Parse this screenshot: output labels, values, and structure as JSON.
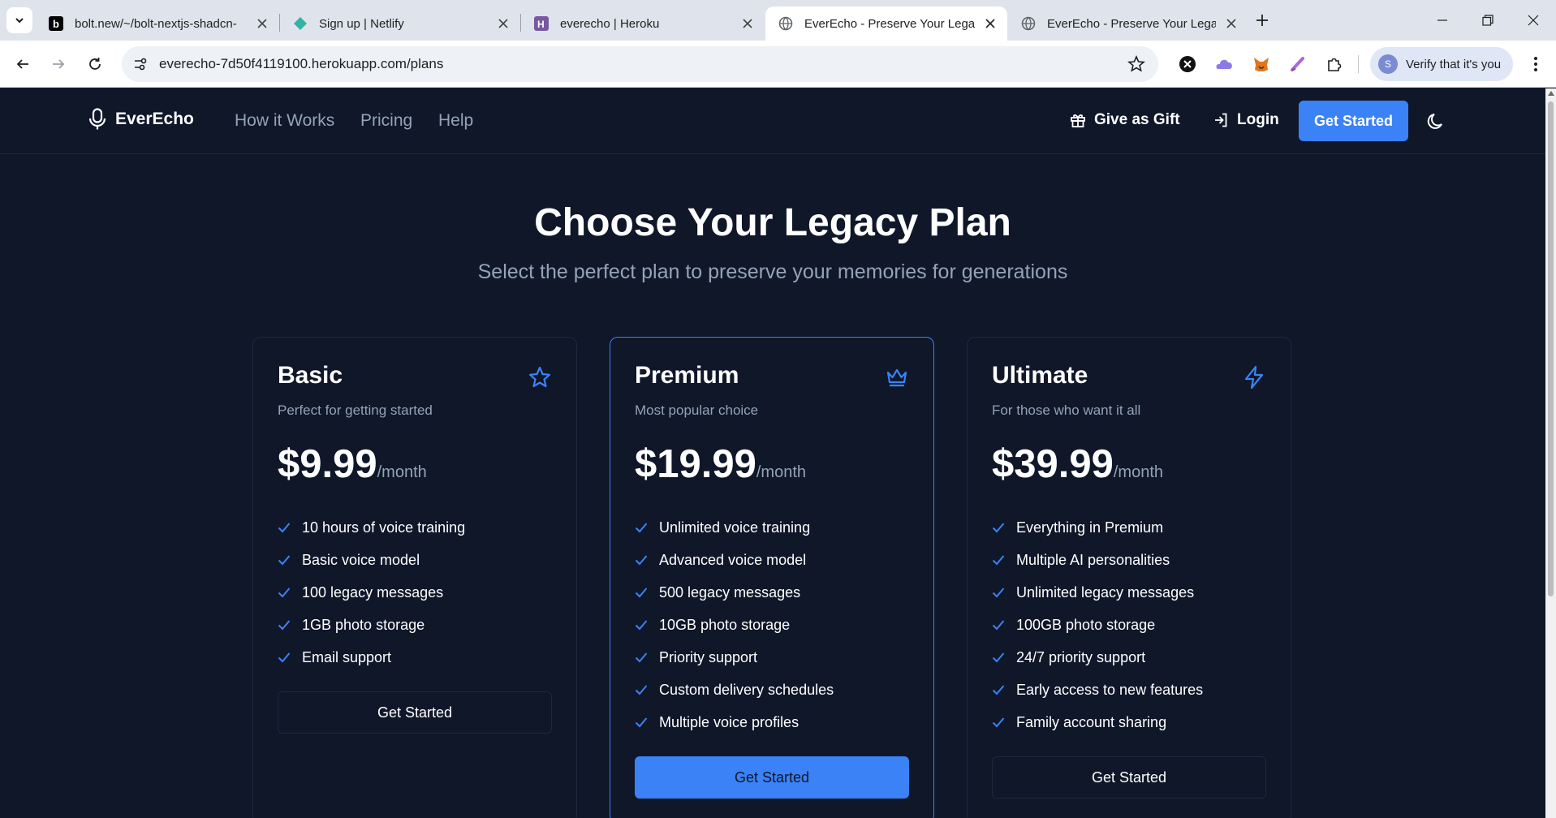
{
  "browser": {
    "tabs": [
      {
        "title": "bolt.new/~/bolt-nextjs-shadcn-",
        "favicon": "bolt-b-icon",
        "active": false
      },
      {
        "title": "Sign up | Netlify",
        "favicon": "netlify-diamond-icon",
        "active": false
      },
      {
        "title": "everecho | Heroku",
        "favicon": "heroku-h-icon",
        "active": false
      },
      {
        "title": "EverEcho - Preserve Your Legacy",
        "favicon": "globe-icon",
        "active": true
      },
      {
        "title": "EverEcho - Preserve Your Legacy",
        "favicon": "globe-icon",
        "active": false
      }
    ],
    "url": "everecho-7d50f4119100.herokuapp.com/plans",
    "profile_label": "Verify that it's you",
    "profile_initial": "S"
  },
  "header": {
    "brand": "EverEcho",
    "nav": [
      "How it Works",
      "Pricing",
      "Help"
    ],
    "gift_label": "Give as Gift",
    "login_label": "Login",
    "cta_label": "Get Started"
  },
  "hero": {
    "title": "Choose Your Legacy Plan",
    "subtitle": "Select the perfect plan to preserve your memories for generations"
  },
  "plans": [
    {
      "name": "Basic",
      "icon": "star-icon",
      "description": "Perfect for getting started",
      "price": "$9.99",
      "period": "/month",
      "features": [
        "10 hours of voice training",
        "Basic voice model",
        "100 legacy messages",
        "1GB photo storage",
        "Email support"
      ],
      "button": "Get Started"
    },
    {
      "name": "Premium",
      "icon": "crown-icon",
      "description": "Most popular choice",
      "price": "$19.99",
      "period": "/month",
      "features": [
        "Unlimited voice training",
        "Advanced voice model",
        "500 legacy messages",
        "10GB photo storage",
        "Priority support",
        "Custom delivery schedules",
        "Multiple voice profiles"
      ],
      "button": "Get Started"
    },
    {
      "name": "Ultimate",
      "icon": "lightning-icon",
      "description": "For those who want it all",
      "price": "$39.99",
      "period": "/month",
      "features": [
        "Everything in Premium",
        "Multiple AI personalities",
        "Unlimited legacy messages",
        "100GB photo storage",
        "24/7 priority support",
        "Early access to new features",
        "Family account sharing"
      ],
      "button": "Get Started"
    }
  ],
  "colors": {
    "background": "#0f1729",
    "accent": "#3b82f6",
    "muted_text": "#94a3b8",
    "border": "#1e293b"
  }
}
